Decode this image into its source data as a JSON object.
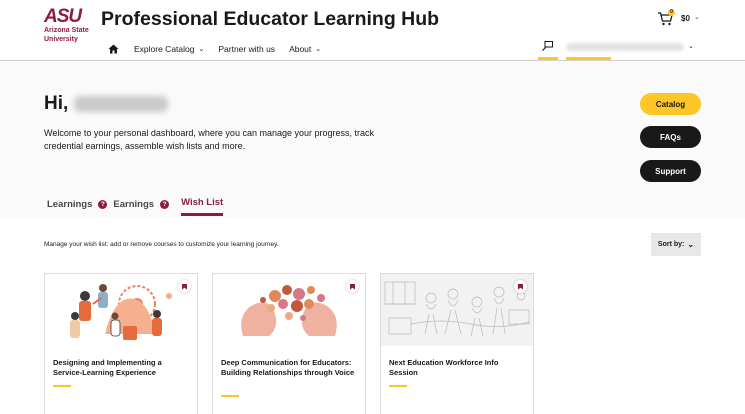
{
  "header": {
    "logo_mark": "ASU",
    "logo_lines": [
      "Arizona State",
      "University"
    ],
    "title": "Professional Educator Learning Hub",
    "cart": {
      "count": "0",
      "total": "$0"
    },
    "nav": [
      {
        "label": "Explore Catalog",
        "has_dropdown": true
      },
      {
        "label": "Partner with us",
        "has_dropdown": false
      },
      {
        "label": "About",
        "has_dropdown": true
      }
    ],
    "icons": {
      "home": "home-icon",
      "cart": "cart-icon",
      "user": "user-account-icon"
    }
  },
  "hero": {
    "greeting": "Hi,",
    "welcome": "Welcome to your personal dashboard, where you can manage your progress, track credential earnings, assemble wish lists and more.",
    "buttons": {
      "catalog": "Catalog",
      "faqs": "FAQs",
      "support": "Support"
    }
  },
  "tabs": [
    {
      "label": "Learnings",
      "help": "?"
    },
    {
      "label": "Earnings",
      "help": "?"
    },
    {
      "label": "Wish List",
      "active": true
    }
  ],
  "wishlist": {
    "intro": "Manage your wish list: add or remove courses to customize your learning journey.",
    "sort_label": "Sort by:",
    "cards": [
      {
        "title": "Designing and Implementing a Service-Learning Experience"
      },
      {
        "title": "Deep Communication for Educators: Building Relationships through Voice"
      },
      {
        "title": "Next Education Workforce Info Session"
      }
    ]
  },
  "colors": {
    "maroon": "#8c1d40",
    "gold": "#ffc627",
    "dark": "#191919"
  }
}
